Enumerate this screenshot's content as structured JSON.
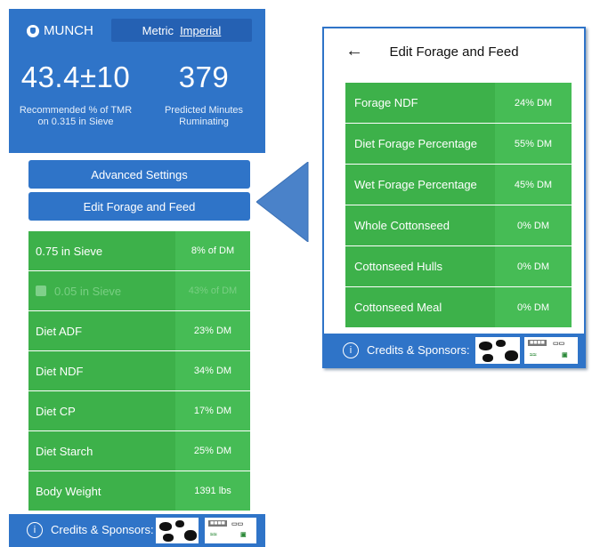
{
  "left": {
    "brand": "MUNCH",
    "unit_metric": "Metric",
    "unit_imperial": "Imperial",
    "stat1_value": "43.4±10",
    "stat1_caption_line1": "Recommended % of TMR",
    "stat1_caption_line2": "on 0.315 in Sieve",
    "stat2_value": "379",
    "stat2_caption_line1": "Predicted Minutes",
    "stat2_caption_line2": "Ruminating",
    "advanced_label": "Advanced Settings",
    "edit_label": "Edit Forage and Feed",
    "rows": [
      {
        "label": "0.75 in Sieve",
        "value": "8% of DM"
      },
      {
        "label": "0.05 in Sieve",
        "value": "43% of DM"
      },
      {
        "label": "Diet ADF",
        "value": "23% DM"
      },
      {
        "label": "Diet NDF",
        "value": "34% DM"
      },
      {
        "label": "Diet CP",
        "value": "17% DM"
      },
      {
        "label": "Diet Starch",
        "value": "25% DM"
      },
      {
        "label": "Body Weight",
        "value": "1391 lbs"
      }
    ],
    "footer_info": "i",
    "footer_credits": "Credits & Sponsors:"
  },
  "right": {
    "back_glyph": "←",
    "title": "Edit Forage and Feed",
    "rows": [
      {
        "label": "Forage NDF",
        "value": "24% DM"
      },
      {
        "label": "Diet Forage Percentage",
        "value": "55% DM"
      },
      {
        "label": "Wet Forage Percentage",
        "value": "45% DM"
      },
      {
        "label": "Whole Cottonseed",
        "value": "0% DM"
      },
      {
        "label": "Cottonseed Hulls",
        "value": "0% DM"
      },
      {
        "label": "Cottonseed Meal",
        "value": "0% DM"
      }
    ],
    "footer_info": "i",
    "footer_credits": "Credits & Sponsors:"
  },
  "colors": {
    "header_blue": "#2f74c8",
    "row_green": "#3db14a",
    "value_green": "#46bc55"
  },
  "icons": {
    "logo": "munch-logo-icon",
    "back": "back-arrow-icon",
    "info": "info-icon",
    "checkbox": "checkbox-icon",
    "pointer": "callout-arrow-icon"
  }
}
